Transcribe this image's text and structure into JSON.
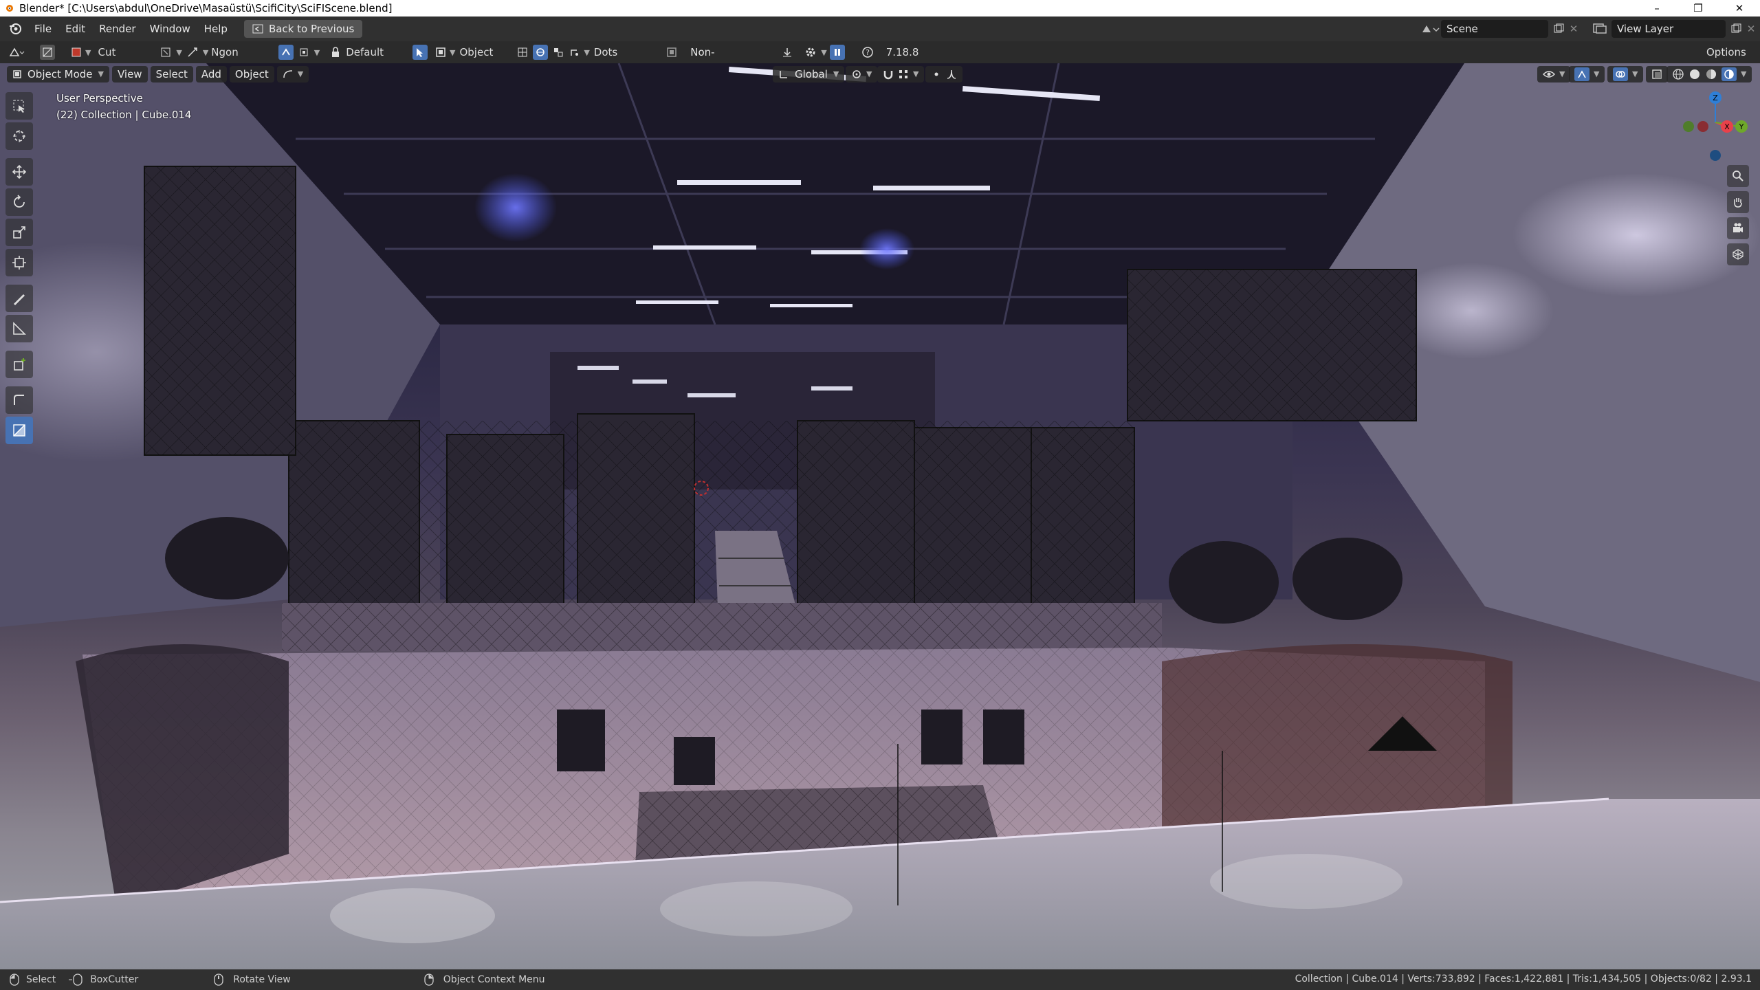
{
  "window": {
    "title": "Blender* [C:\\Users\\abdul\\OneDrive\\Masaüstü\\ScifiCity\\SciFIScene.blend]",
    "controls": [
      "–",
      "❐",
      "✕"
    ]
  },
  "menubar": {
    "menus": [
      "File",
      "Edit",
      "Render",
      "Window",
      "Help"
    ],
    "back_button": "Back to Previous",
    "scene_label": "Scene",
    "view_layer_label": "View Layer"
  },
  "toolsettings": {
    "tool_name": "Cut",
    "shape": "Ngon",
    "mode": "Default",
    "target": "Object",
    "display": "Dots",
    "boolean_mode": "Non-Destructive",
    "version": "7.18.8",
    "options_label": "Options"
  },
  "viewport_header": {
    "mode": "Object Mode",
    "menus": [
      "View",
      "Select",
      "Add",
      "Object"
    ],
    "orientation": "Global"
  },
  "viewport_overlay": {
    "perspective": "User Perspective",
    "collection": "(22) Collection | Cube.014"
  },
  "gizmo": {
    "z": "Z",
    "x": "X",
    "y": "Y"
  },
  "statusbar": {
    "select": "Select",
    "boxcutter": "BoxCutter",
    "rotate": "Rotate View",
    "context": "Object Context Menu",
    "stats": "Collection | Cube.014 | Verts:733,892 | Faces:1,422,881 | Tris:1,434,505 | Objects:0/82 | 2.93.1"
  },
  "colors": {
    "accent_blue": "#4772b3",
    "axis_x": "#e8414a",
    "axis_y": "#6ea82a",
    "axis_z": "#2f7fd6"
  }
}
